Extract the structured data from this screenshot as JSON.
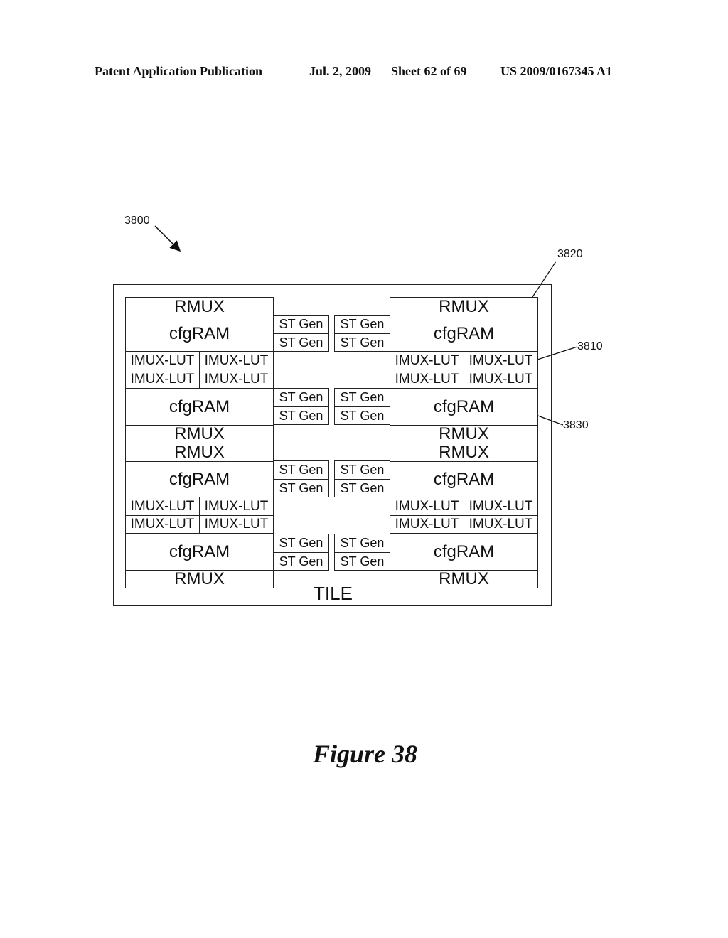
{
  "header": {
    "publication": "Patent Application Publication",
    "date": "Jul. 2, 2009",
    "sheet": "Sheet 62 of 69",
    "number": "US 2009/0167345 A1"
  },
  "figure": {
    "label": "Figure 38",
    "tile_label": "TILE",
    "refs": {
      "diagram": "3800",
      "rmux": "3820",
      "imux": "3810",
      "cfgram": "3830"
    }
  },
  "blocks": {
    "rmux": "RMUX",
    "cfgram": "cfgRAM",
    "imux": "IMUX-LUT",
    "stgen": "ST Gen"
  }
}
